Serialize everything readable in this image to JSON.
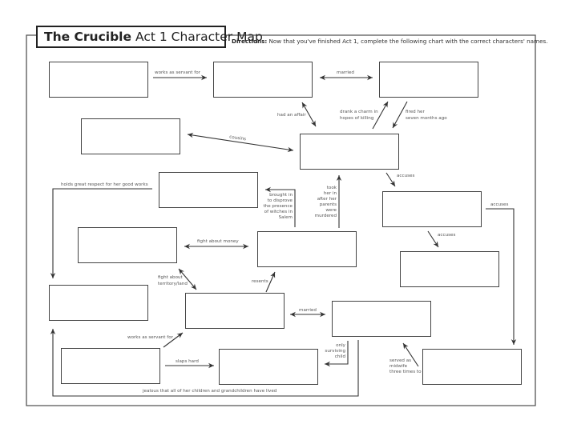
{
  "header": {
    "title_bold": "The Crucible",
    "title_rest": "Act 1 Character Map",
    "directions_label": "Directions:",
    "directions_text": "Now that you've finished Act 1, complete the following chart with the correct characters' names."
  },
  "boxes": [
    {
      "id": 1,
      "value": ""
    },
    {
      "id": 2,
      "value": ""
    },
    {
      "id": 3,
      "value": ""
    },
    {
      "id": 4,
      "value": ""
    },
    {
      "id": 5,
      "value": ""
    },
    {
      "id": 6,
      "value": ""
    },
    {
      "id": 7,
      "value": ""
    },
    {
      "id": 8,
      "value": ""
    },
    {
      "id": 9,
      "value": ""
    },
    {
      "id": 10,
      "value": ""
    },
    {
      "id": 11,
      "value": ""
    },
    {
      "id": 12,
      "value": ""
    },
    {
      "id": 13,
      "value": ""
    },
    {
      "id": 14,
      "value": ""
    },
    {
      "id": 15,
      "value": ""
    },
    {
      "id": 16,
      "value": ""
    }
  ],
  "relations": {
    "works_as_servant_for_1": "works as servant for",
    "married_1": "married",
    "had_an_affair": "had an affair",
    "drank_charm_1": "drank a charm in",
    "drank_charm_2": "hopes of killing",
    "fired_her_1": "fired her",
    "fired_her_2": "seven months ago",
    "cousins": "cousins",
    "accuses_1": "accuses",
    "accuses_2": "accuses",
    "accuses_3": "accuses",
    "holds_respect": "holds great respect for her good works",
    "brought_in": [
      "brought in",
      "to disprove",
      "the presence",
      "of witches in",
      "Salem"
    ],
    "took_her_in": [
      "took",
      "her in",
      "after her",
      "parents",
      "were",
      "murdered"
    ],
    "fight_money": "fight about money",
    "fight_land_1": "fight about",
    "fight_land_2": "territory/land",
    "resents": "resents",
    "married_2": "married",
    "works_as_servant_for_2": "works as servant for",
    "slaps_hard": "slaps hard",
    "only_child": [
      "only",
      "surviving",
      "child"
    ],
    "midwife": [
      "served as",
      "midwife",
      "three times to"
    ],
    "jealous": "jealous that all of her children and grandchildren have lived"
  }
}
